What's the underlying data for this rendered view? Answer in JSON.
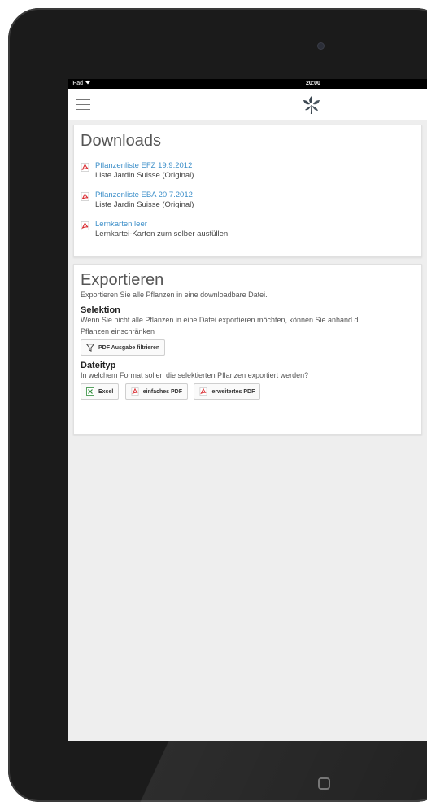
{
  "status": {
    "device": "iPad",
    "time": "20:00"
  },
  "downloads": {
    "title": "Downloads",
    "items": [
      {
        "link": "Pflanzenliste EFZ 19.9.2012",
        "sub": "Liste Jardin Suisse (Original)"
      },
      {
        "link": "Pflanzenliste EBA 20.7.2012",
        "sub": "Liste Jardin Suisse (Original)"
      },
      {
        "link": "Lernkarten leer",
        "sub": "Lernkartei-Karten zum selber ausfüllen"
      }
    ]
  },
  "export": {
    "title": "Exportieren",
    "intro": "Exportieren Sie alle Pflanzen in eine downloadbare Datei.",
    "selection": {
      "title": "Selektion",
      "text_line1": "Wenn Sie nicht alle Pflanzen in eine Datei exportieren möchten, können Sie anhand d",
      "text_line2": "Pflanzen einschränken",
      "filter_button": "PDF Ausgabe filtrieren"
    },
    "filetype": {
      "title": "Dateityp",
      "text": "In welchem Format sollen die selektierten Pflanzen exportiert werden?",
      "buttons": {
        "excel": "Excel",
        "simple_pdf": "einfaches PDF",
        "extended_pdf": "erweitertes PDF"
      }
    }
  },
  "colors": {
    "link": "#3d8fc9",
    "pdf_red": "#d9262b",
    "excel_green": "#2e8b3a"
  },
  "icons": {
    "menu": "hamburger-menu-icon",
    "logo": "plant-leaves-logo-icon",
    "pdf": "pdf-file-icon",
    "excel": "excel-file-icon",
    "filter": "filter-funnel-icon",
    "home": "home-button-icon"
  }
}
